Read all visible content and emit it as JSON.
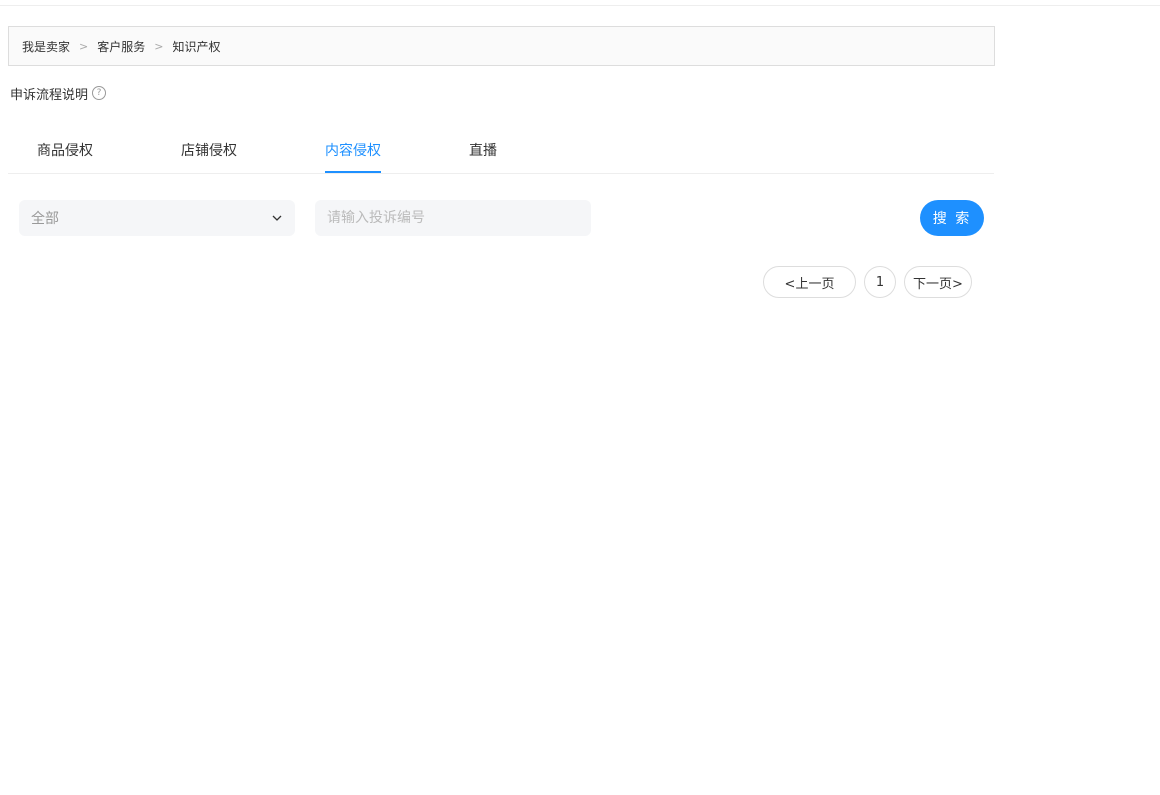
{
  "breadcrumb": {
    "items": [
      "我是卖家",
      "客户服务",
      "知识产权"
    ],
    "separator": ">"
  },
  "appeal": {
    "label": "申诉流程说明",
    "help_icon": "?"
  },
  "tabs": [
    {
      "label": "商品侵权",
      "active": false
    },
    {
      "label": "店铺侵权",
      "active": false
    },
    {
      "label": "内容侵权",
      "active": true
    },
    {
      "label": "直播",
      "active": false
    }
  ],
  "filter": {
    "select_value": "全部",
    "search_placeholder": "请输入投诉编号",
    "search_button": "搜 索"
  },
  "pagination": {
    "prev_label": "<上一页",
    "current_page": "1",
    "next_label": "下一页>"
  },
  "colors": {
    "accent": "#1e90ff",
    "text": "#333333",
    "muted": "#999999",
    "field_bg": "#f5f6f8"
  }
}
